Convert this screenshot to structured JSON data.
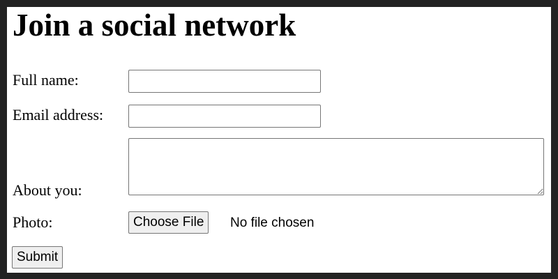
{
  "form": {
    "title": "Join a social network",
    "full_name": {
      "label": "Full name:",
      "value": "",
      "placeholder": ""
    },
    "email": {
      "label": "Email address:",
      "value": "",
      "placeholder": ""
    },
    "about": {
      "label": "About you:",
      "value": "",
      "placeholder": ""
    },
    "photo": {
      "label": "Photo:",
      "button_label": "Choose File",
      "status": "No file chosen"
    },
    "submit_label": "Submit"
  },
  "colors": {
    "page_border": "#222222",
    "background": "#ffffff",
    "field_border": "#767676",
    "button_background": "#efefef"
  }
}
